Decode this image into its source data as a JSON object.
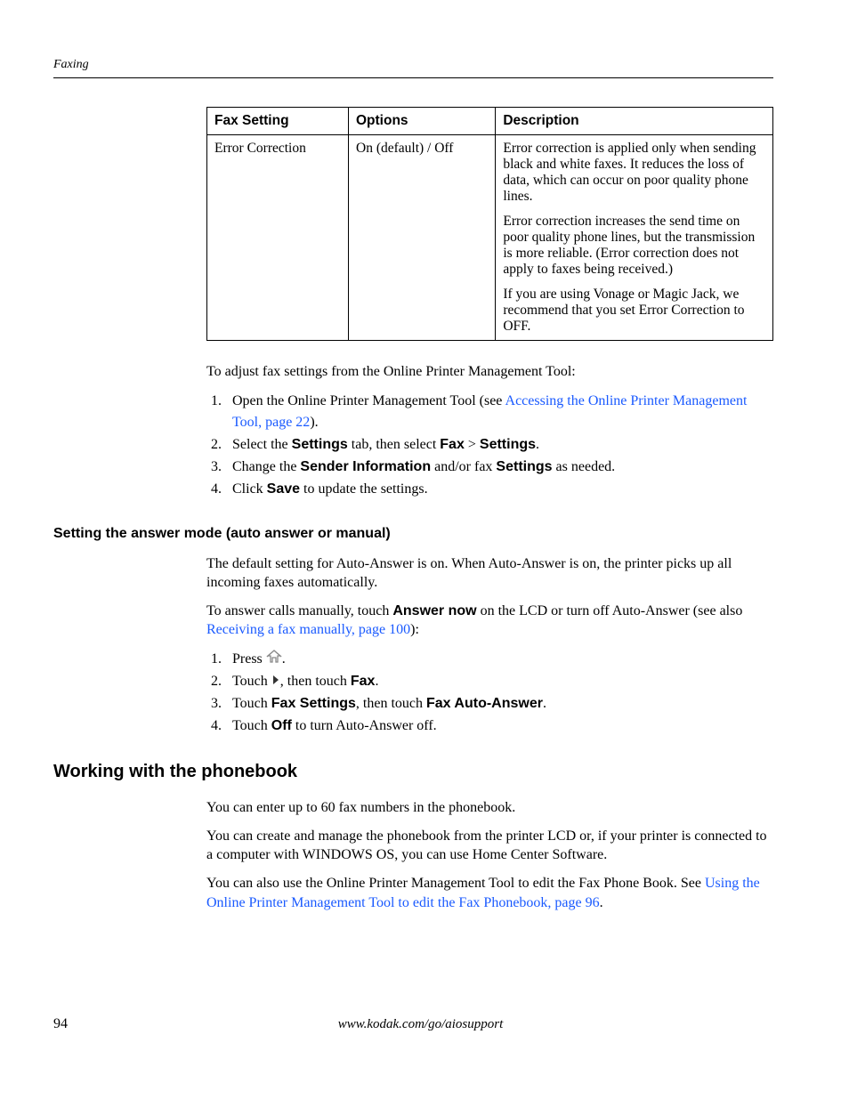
{
  "header": {
    "section": "Faxing"
  },
  "table": {
    "headers": {
      "col1": "Fax Setting",
      "col2": "Options",
      "col3": "Description"
    },
    "row": {
      "setting": "Error Correction",
      "options": "On (default) / Off",
      "desc1": "Error correction is applied only when sending black and white faxes. It reduces the loss of data, which can occur on poor quality phone lines.",
      "desc2": "Error correction increases the send time on poor quality phone lines, but the transmission is more reliable. (Error correction does not apply to faxes being received.)",
      "desc3": "If you are using Vonage or Magic Jack, we recommend that you set Error Correction to OFF."
    }
  },
  "intro": "To adjust fax settings from the Online Printer Management Tool:",
  "steps1": {
    "s1a": "Open the Online Printer Management Tool (see ",
    "s1link": "Accessing the Online Printer Management Tool, page 22",
    "s1b": ").",
    "s2a": "Select the ",
    "s2b": "Settings",
    "s2c": " tab, then select ",
    "s2d": "Fax",
    "s2e": " > ",
    "s2f": "Settings",
    "s2g": ".",
    "s3a": "Change the ",
    "s3b": "Sender Information",
    "s3c": " and/or fax ",
    "s3d": "Settings",
    "s3e": " as needed.",
    "s4a": "Click ",
    "s4b": "Save",
    "s4c": " to update the settings."
  },
  "subheading1": "Setting the answer mode (auto answer or manual)",
  "answermode": {
    "p1": "The default setting for Auto-Answer is on. When Auto-Answer is on, the printer picks up all incoming faxes automatically.",
    "p2a": "To answer calls manually, touch ",
    "p2b": "Answer now",
    "p2c": " on the LCD or turn off Auto-Answer (see also ",
    "p2link": "Receiving a fax manually, page 100",
    "p2d": "):"
  },
  "steps2": {
    "s1a": "Press ",
    "s1b": ".",
    "s2a": "Touch ",
    "s2b": ", then touch ",
    "s2c": "Fax",
    "s2d": ".",
    "s3a": "Touch ",
    "s3b": "Fax Settings",
    "s3c": ", then touch ",
    "s3d": "Fax Auto-Answer",
    "s3e": ".",
    "s4a": "Touch ",
    "s4b": "Off",
    "s4c": " to turn Auto-Answer off."
  },
  "section2": "Working with the phonebook",
  "phonebook": {
    "p1": "You can enter up to 60 fax numbers in the phonebook.",
    "p2": "You can create and manage the phonebook from the printer LCD or, if your printer is connected to a computer with WINDOWS OS, you can use Home Center Software.",
    "p3a": "You can also use the Online Printer Management Tool to edit the Fax Phone Book. See ",
    "p3link": "Using the Online Printer Management Tool to edit the Fax Phonebook, page 96",
    "p3b": "."
  },
  "footer": {
    "page": "94",
    "url": "www.kodak.com/go/aiosupport"
  }
}
